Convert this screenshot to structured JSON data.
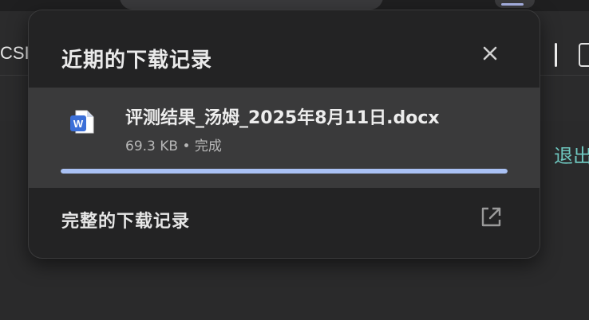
{
  "background": {
    "left_tab_text": "CSI",
    "exit_link": "退出"
  },
  "downloads_bubble": {
    "title": "近期的下载记录",
    "close_icon": "close-icon",
    "items": [
      {
        "file_name": "评测结果_汤姆_2025年8月11日.docx",
        "meta": "69.3 KB • 完成",
        "file_icon": "word-document-icon",
        "progress": 1.0
      }
    ],
    "footer_label": "完整的下载记录",
    "footer_icon": "open-external-icon"
  },
  "colors": {
    "popup_bg": "#232324",
    "item_bg": "#3a3a3b",
    "progress": "#a9c1f4",
    "word_blue": "#3b6fd8",
    "exit_link": "#6fc8c0"
  }
}
